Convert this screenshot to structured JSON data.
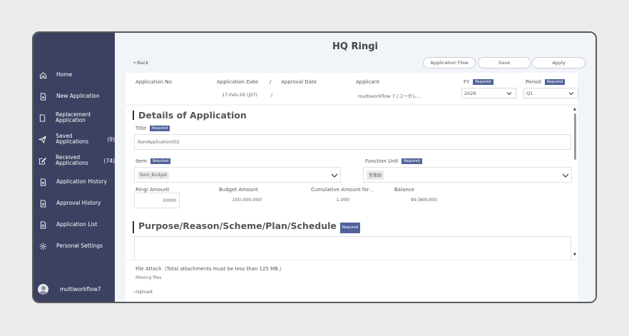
{
  "sidebar": {
    "items": [
      {
        "label": "Home",
        "icon": "home-icon"
      },
      {
        "label": "New Application",
        "icon": "new-document-icon"
      },
      {
        "label": "Replacement Application",
        "icon": "document-icon"
      },
      {
        "label": "Saved Applications",
        "count": "(9)",
        "icon": "send-icon"
      },
      {
        "label": "Received Applications",
        "count": "(74)",
        "icon": "edit-document-icon"
      },
      {
        "label": "Application History",
        "icon": "list-document-icon"
      },
      {
        "label": "Approval History",
        "icon": "list-document-icon"
      },
      {
        "label": "Application List",
        "icon": "list-document-icon"
      },
      {
        "label": "Personal Settings",
        "icon": "gear-icon"
      }
    ],
    "user": {
      "name": "multiworkflow7"
    }
  },
  "page": {
    "title": "HQ Ringi",
    "back": "←Back",
    "buttons": {
      "flow": "Application Flow",
      "save": "Save",
      "apply": "Apply"
    }
  },
  "header": {
    "application_no_label": "Application No",
    "application_date_label": "Application Date",
    "slash": "/",
    "approval_date_label": "Approval Date",
    "applicant_label": "Applicant",
    "fy_label": "FY",
    "period_label": "Period",
    "required": "Required",
    "application_date": "17-Feb-26 (JST)",
    "approval_date_sep": "/",
    "applicant": "multiworkflow 7 (コーポレ...",
    "fy_value": "2026",
    "period_value": "Q1"
  },
  "details": {
    "heading": "Details of Application",
    "title_label": "Title",
    "title_value": "ItemApplication002",
    "item_label": "Item",
    "item_value": "Item_Budget",
    "function_unit_label": "Function Unit",
    "function_unit_value": "営業部",
    "ringi_amount_label": "Ringi Amount",
    "budget_amount_label": "Budget Amount",
    "cumulative_label": "Cumulative Amount for...",
    "balance_label": "Balance",
    "ringi_amount": "30000",
    "budget_amount": "100,000,000",
    "cumulative_amount": "1,000",
    "balance": "99,969,000"
  },
  "purpose": {
    "heading": "Purpose/Reason/Scheme/Plan/Schedule"
  },
  "files": {
    "label": "File Attach（Total attachments must be less than 125 MB.）",
    "missing": "Missing files",
    "upload": "Upload"
  },
  "colors": {
    "sidebar": "#3c4161",
    "required_badge": "#51629b"
  }
}
